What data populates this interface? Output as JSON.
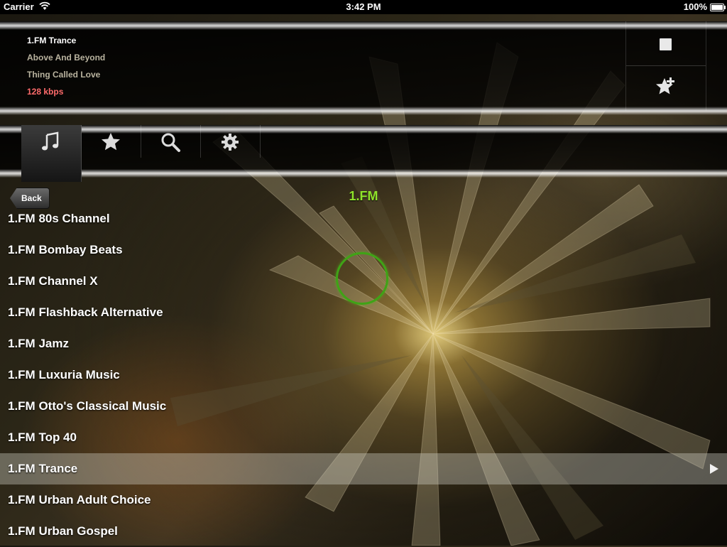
{
  "status_bar": {
    "carrier": "Carrier",
    "time": "3:42 PM",
    "battery": "100%"
  },
  "now_playing": {
    "station": "1.FM Trance",
    "artist": "Above And Beyond",
    "track": "Thing Called Love",
    "bitrate": "128 kbps",
    "icons": {
      "stop": "stop-icon",
      "add_favorite": "star-plus-icon"
    }
  },
  "tabs": [
    {
      "icon": "music-note-icon",
      "active": true
    },
    {
      "icon": "star-icon",
      "active": false
    },
    {
      "icon": "search-icon",
      "active": false
    },
    {
      "icon": "gear-icon",
      "active": false
    }
  ],
  "nav": {
    "back_label": "Back",
    "title": "1.FM"
  },
  "stations": [
    "1.FM 80s Channel",
    "1.FM Bombay Beats",
    "1.FM Channel X",
    "1.FM Flashback Alternative",
    "1.FM Jamz",
    "1.FM Luxuria Music",
    "1.FM Otto's Classical Music",
    "1.FM Top 40",
    "1.FM Trance",
    "1.FM Urban Adult Choice",
    "1.FM Urban Gospel"
  ],
  "selected_station": "1.FM Trance",
  "colors": {
    "title_green": "#8fe32a",
    "bitrate_red": "#ff6b6b",
    "spinner_green": "#3fa316"
  }
}
